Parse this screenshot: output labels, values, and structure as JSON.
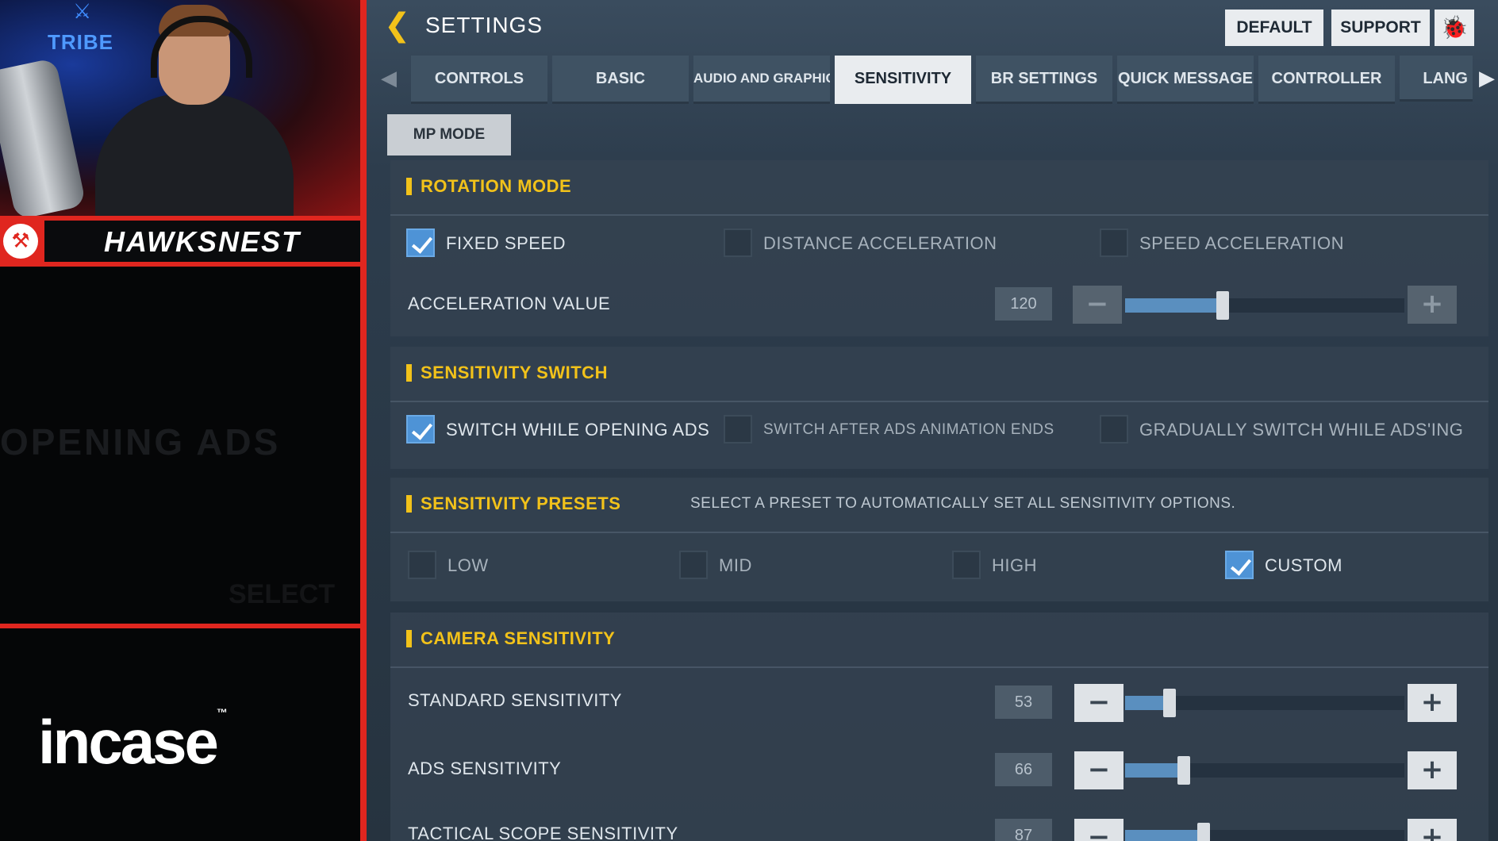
{
  "stream": {
    "brand": "TRIBE",
    "streamer_name": "HAWKSNEST",
    "ghost_text": "OPENING ADS",
    "ghost_small": "SELECT",
    "sponsor": "incase",
    "sponsor_tm": "™"
  },
  "header": {
    "title": "SETTINGS",
    "default_label": "DEFAULT",
    "support_label": "SUPPORT"
  },
  "tabs": [
    "CONTROLS",
    "BASIC",
    "AUDIO AND GRAPHICS",
    "SENSITIVITY",
    "BR SETTINGS",
    "QUICK MESSAGE",
    "CONTROLLER",
    "LANG"
  ],
  "active_tab": "SENSITIVITY",
  "subtab": "MP MODE",
  "rotation_mode": {
    "title": "ROTATION MODE",
    "options": [
      {
        "label": "FIXED SPEED",
        "checked": true
      },
      {
        "label": "DISTANCE ACCELERATION",
        "checked": false
      },
      {
        "label": "SPEED ACCELERATION",
        "checked": false
      }
    ],
    "acceleration": {
      "label": "ACCELERATION VALUE",
      "value": "120",
      "fraction": 0.35
    }
  },
  "sensitivity_switch": {
    "title": "SENSITIVITY SWITCH",
    "options": [
      {
        "label": "SWITCH WHILE OPENING ADS",
        "checked": true
      },
      {
        "label": "SWITCH AFTER ADS ANIMATION ENDS",
        "checked": false
      },
      {
        "label": "GRADUALLY SWITCH WHILE ADS'ING",
        "checked": false
      }
    ]
  },
  "sensitivity_presets": {
    "title": "SENSITIVITY PRESETS",
    "description": "SELECT A PRESET TO AUTOMATICALLY SET ALL SENSITIVITY OPTIONS.",
    "options": [
      {
        "label": "LOW",
        "checked": false
      },
      {
        "label": "MID",
        "checked": false
      },
      {
        "label": "HIGH",
        "checked": false
      },
      {
        "label": "CUSTOM",
        "checked": true
      }
    ]
  },
  "camera_sensitivity": {
    "title": "CAMERA SENSITIVITY",
    "rows": [
      {
        "label": "STANDARD SENSITIVITY",
        "value": "53",
        "fraction": 0.16
      },
      {
        "label": "ADS SENSITIVITY",
        "value": "66",
        "fraction": 0.21
      },
      {
        "label": "TACTICAL SCOPE SENSITIVITY",
        "value": "87",
        "fraction": 0.28
      }
    ]
  },
  "colors": {
    "accent_yellow": "#f2c21a",
    "checkbox_blue": "#4e93d6",
    "stream_red": "#e0261f"
  }
}
